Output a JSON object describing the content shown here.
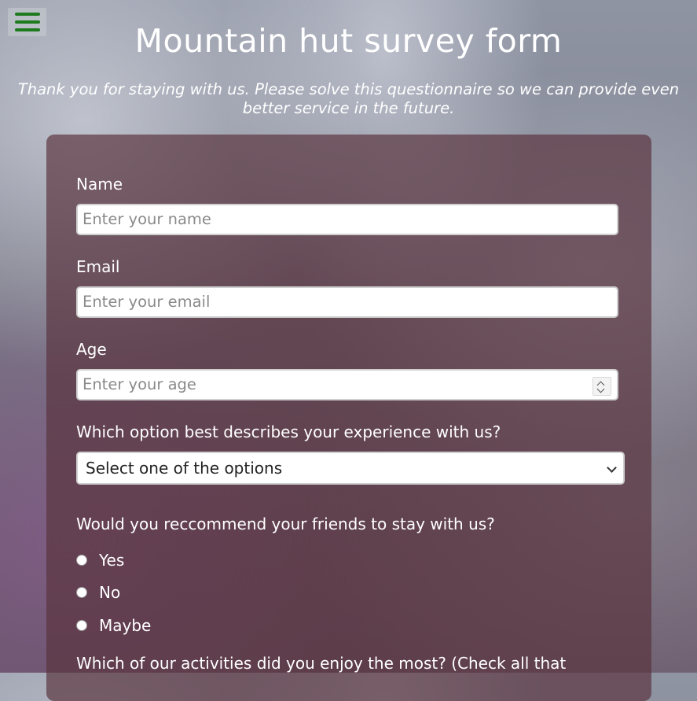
{
  "header": {
    "title": "Mountain hut survey form",
    "description": "Thank you for staying with us. Please solve this questionnaire so we can provide even better service in the future."
  },
  "nav": {
    "menu_icon": "hamburger-menu-icon",
    "menu_color": "#1d7a1d"
  },
  "form": {
    "name": {
      "label": "Name",
      "placeholder": "Enter your name"
    },
    "email": {
      "label": "Email",
      "placeholder": "Enter your email"
    },
    "age": {
      "label": "Age",
      "placeholder": "Enter your age"
    },
    "experience": {
      "label": "Which option best describes your experience with us?",
      "selected": "Select one of the options"
    },
    "recommend": {
      "label": "Would you reccommend your friends to stay with us?",
      "options": [
        "Yes",
        "No",
        "Maybe"
      ]
    },
    "activities": {
      "label": "Which of our activities did you enjoy the most? (Check all that"
    }
  }
}
